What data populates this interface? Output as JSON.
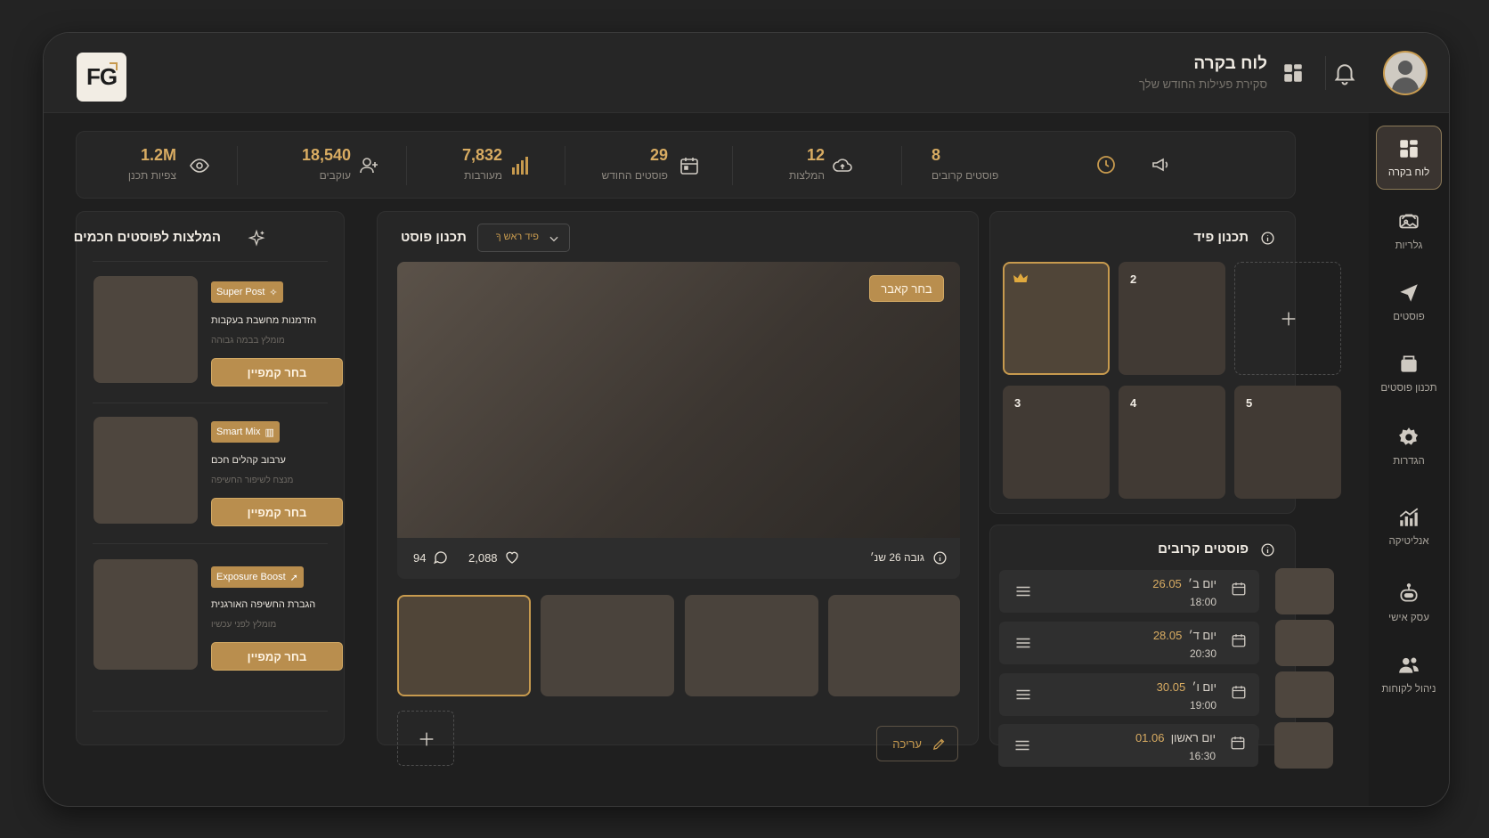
{
  "header": {
    "logo": "FG",
    "title": "לוח בקרה",
    "subtitle": "סקירת פעילות החודש שלך"
  },
  "nav": [
    {
      "label": "לוח בקרה",
      "icon": "dashboard-icon",
      "active": true
    },
    {
      "label": "גלריות",
      "icon": "gallery-icon"
    },
    {
      "label": "פוסטים",
      "icon": "send-icon"
    },
    {
      "label": "תכנון פוסטים",
      "icon": "planner-icon"
    },
    {
      "label": "הגדרות",
      "icon": "gear-icon"
    },
    {
      "label": "אנליטיקה",
      "icon": "analytics-icon"
    },
    {
      "label": "עסק אישי",
      "icon": "robot-icon"
    },
    {
      "label": "ניהול לקוחות",
      "icon": "users-icon"
    }
  ],
  "stats": [
    {
      "value": "1.2M",
      "label": "צפיות תכנן",
      "icon": "eye-icon"
    },
    {
      "value": "18,540",
      "label": "עוקבים",
      "icon": "user-plus-icon"
    },
    {
      "value": "7,832",
      "label": "מעורבות",
      "icon": "bar-chart-icon"
    },
    {
      "value": "29",
      "label": "פוסטים החודש",
      "icon": "calendar-icon"
    },
    {
      "value": "12",
      "label": "המלצות",
      "icon": "cloud-icon"
    },
    {
      "value": "8",
      "label": "פוסטים קרובים",
      "icon": "clock-icon"
    }
  ],
  "recommendations": {
    "title": "המלצות לפוסטים חכמים",
    "items": [
      {
        "tag": "Super Post",
        "title": "הזדמנות מחשבת בעקבות",
        "sub": "מומלץ בבמה גבוהה",
        "button": "בחר קמפיין"
      },
      {
        "tag": "Smart Mix",
        "title": "ערבוב קהלים חכם",
        "sub": "מנצח לשיפור החשיפה",
        "button": "בחר קמפיין"
      },
      {
        "tag": "Exposure Boost",
        "title": "הגברת החשיפה האורגנית",
        "sub": "מומלץ לפני עכשיו",
        "button": "בחר קמפיין"
      }
    ]
  },
  "post_planner": {
    "title": "תכנון פוסט",
    "dropdown": "פיד ראש ךָ",
    "cover_button": "בחר קאבר",
    "comments": "94",
    "likes": "2,088",
    "height_info": "גובה 26 שנ׳",
    "edit_button": "עריכה"
  },
  "feed_planner": {
    "title": "תכנון פיד",
    "tiles": [
      "2",
      "3",
      "4",
      "5"
    ]
  },
  "upcoming": {
    "title": "פוסטים קרובים",
    "rows": [
      {
        "day": "יום ב׳",
        "date": "26.05",
        "time": "18:00"
      },
      {
        "day": "יום ד׳",
        "date": "28.05",
        "time": "20:30"
      },
      {
        "day": "יום ו׳",
        "date": "30.05",
        "time": "19:00"
      },
      {
        "day": "יום ראשון",
        "date": "01.06",
        "time": "16:30"
      }
    ]
  },
  "colors": {
    "accent": "#c79a4e",
    "background": "#1f1f1f",
    "card": "#262626"
  }
}
